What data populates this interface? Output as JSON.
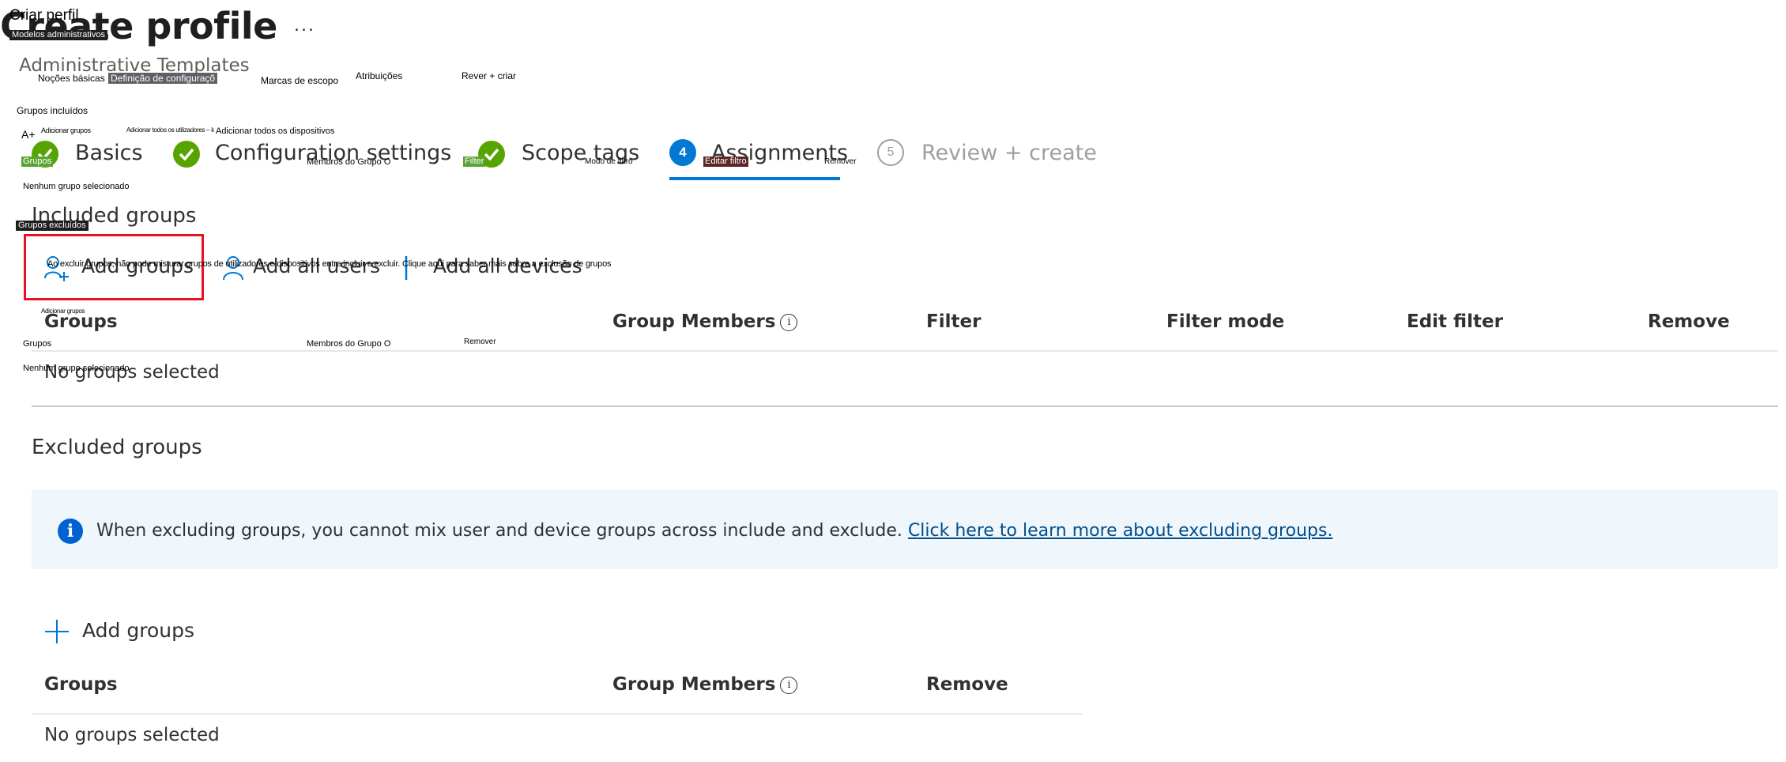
{
  "header": {
    "title": "Create profile",
    "subtitle": "Administrative Templates",
    "more_label": "..."
  },
  "steps": [
    {
      "number": "1",
      "label": "Basics",
      "state": "done"
    },
    {
      "number": "2",
      "label": "Configuration settings",
      "state": "done"
    },
    {
      "number": "3",
      "label": "Scope tags",
      "state": "done"
    },
    {
      "number": "4",
      "label": "Assignments",
      "state": "active"
    },
    {
      "number": "5",
      "label": "Review + create",
      "state": "todo"
    }
  ],
  "included": {
    "heading": "Included groups",
    "commands": {
      "add_groups": "Add groups",
      "add_all_users": "Add all users",
      "add_all_devices": "Add all devices"
    },
    "columns": [
      "Groups",
      "Group Members",
      "Filter",
      "Filter mode",
      "Edit filter",
      "Remove"
    ],
    "empty_text": "No groups selected"
  },
  "excluded": {
    "heading": "Excluded groups",
    "info_text": "When excluding groups, you cannot mix user and device groups across include and exclude.",
    "info_link": "Click here to learn more about excluding groups.",
    "add_groups": "Add groups",
    "columns": [
      "Groups",
      "Group Members",
      "Remove"
    ],
    "empty_text": "No groups selected"
  },
  "overlay_labels": {
    "title": "Criar perfil",
    "subtitle": "Modelos administrativos",
    "tab_basics": "Noções básicas",
    "tab_config": "Definição de configuraçõ",
    "tab_scope": "Marcas de escopo",
    "tab_assign": "Atribuições",
    "tab_review": "Rever + criar",
    "included_heading": "Grupos incluídos",
    "add_icon": "A+",
    "add_groups": "Adicionar grupos",
    "add_all_users": "Adicionar todos os utilizadores – k",
    "add_all_devices": "Adicionar todos os dispositivos",
    "col_groups": "Grupos",
    "col_members": "Membros do Grupo O",
    "col_filter": "Filter",
    "col_filter_mode": "Modo de filtro",
    "col_edit_filter": "Editar filtro",
    "col_remove": "Remover",
    "empty": "Nenhum grupo selecionado",
    "excluded_heading": "Grupos excluídos",
    "info_text": "Ao excluir grupos, não pode misturar grupos de utilizadores e dispositivos entre incluir e excluir. Clique aqui para saber mais sobre a exclusão de grupos",
    "add_groups_2": "Adicionar grupos",
    "col_groups_2": "Grupos",
    "col_members_2": "Membros do Grupo O",
    "col_remove_2": "Remover",
    "empty_2": "Nenhum grupo selecionado"
  },
  "colors": {
    "accent": "#0078d4",
    "done": "#57a300",
    "highlight_box": "#e81123",
    "info_bg": "#eff6fc",
    "link": "#004e8c"
  }
}
